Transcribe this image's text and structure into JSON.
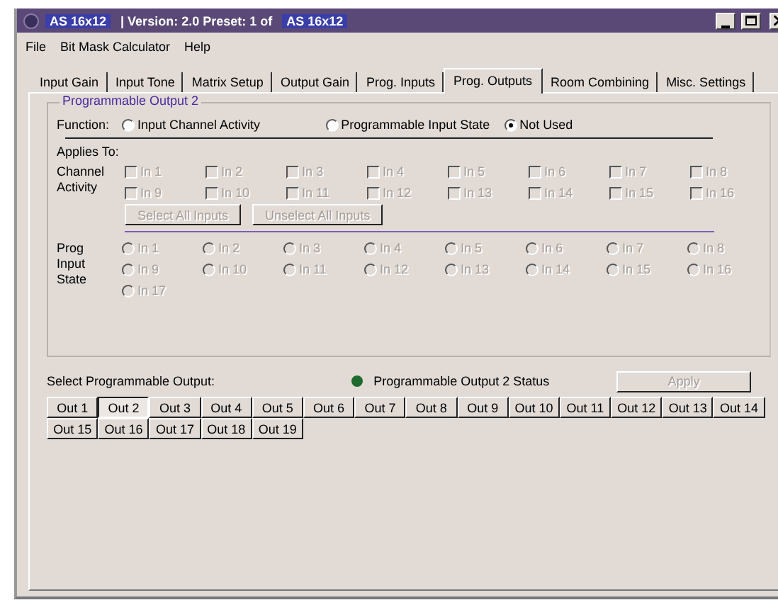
{
  "window": {
    "title_parts": [
      {
        "text": "AS 16x12",
        "highlighted": true
      },
      {
        "text": "| Version: 2.0  Preset: 1 of",
        "highlighted": false
      },
      {
        "text": "AS 16x12",
        "highlighted": true
      }
    ]
  },
  "menu": [
    "File",
    "Bit Mask Calculator",
    "Help"
  ],
  "tabs": [
    {
      "label": "Input Gain",
      "selected": false
    },
    {
      "label": "Input Tone",
      "selected": false
    },
    {
      "label": "Matrix Setup",
      "selected": false
    },
    {
      "label": "Output Gain",
      "selected": false
    },
    {
      "label": "Prog. Inputs",
      "selected": false
    },
    {
      "label": "Prog. Outputs",
      "selected": true
    },
    {
      "label": "Room Combining",
      "selected": false
    },
    {
      "label": "Misc. Settings",
      "selected": false
    }
  ],
  "group": {
    "title": "Programmable Output 2",
    "function_label": "Function:",
    "function_options": [
      {
        "label": "Input Channel Activity",
        "selected": false
      },
      {
        "label": "Programmable Input State",
        "selected": false
      },
      {
        "label": "Not Used",
        "selected": true
      }
    ],
    "applies_to": "Applies To:",
    "channel_activity": {
      "label": "Channel Activity",
      "items": [
        {
          "label": "In 1",
          "checked": false,
          "disabled": true
        },
        {
          "label": "In 2",
          "checked": false,
          "disabled": true
        },
        {
          "label": "In 3",
          "checked": false,
          "disabled": true
        },
        {
          "label": "In 4",
          "checked": false,
          "disabled": true
        },
        {
          "label": "In 5",
          "checked": false,
          "disabled": true
        },
        {
          "label": "In 6",
          "checked": false,
          "disabled": true
        },
        {
          "label": "In 7",
          "checked": false,
          "disabled": true
        },
        {
          "label": "In 8",
          "checked": false,
          "disabled": true
        },
        {
          "label": "In 9",
          "checked": false,
          "disabled": true
        },
        {
          "label": "In 10",
          "checked": false,
          "disabled": true
        },
        {
          "label": "In 11",
          "checked": false,
          "disabled": true
        },
        {
          "label": "In 12",
          "checked": false,
          "disabled": true
        },
        {
          "label": "In 13",
          "checked": false,
          "disabled": true
        },
        {
          "label": "In 14",
          "checked": false,
          "disabled": true
        },
        {
          "label": "In 15",
          "checked": false,
          "disabled": true
        },
        {
          "label": "In 16",
          "checked": false,
          "disabled": true
        }
      ],
      "buttons": [
        {
          "label": "Select All Inputs",
          "disabled": true
        },
        {
          "label": "Unselect All Inputs",
          "disabled": true
        }
      ]
    },
    "prog_input_state": {
      "label": "Prog Input State",
      "items": [
        {
          "label": "In 1",
          "selected": false,
          "disabled": true
        },
        {
          "label": "In 2",
          "selected": false,
          "disabled": true
        },
        {
          "label": "In 3",
          "selected": false,
          "disabled": true
        },
        {
          "label": "In 4",
          "selected": false,
          "disabled": true
        },
        {
          "label": "In 5",
          "selected": false,
          "disabled": true
        },
        {
          "label": "In 6",
          "selected": false,
          "disabled": true
        },
        {
          "label": "In 7",
          "selected": false,
          "disabled": true
        },
        {
          "label": "In 8",
          "selected": false,
          "disabled": true
        },
        {
          "label": "In 9",
          "selected": false,
          "disabled": true
        },
        {
          "label": "In 10",
          "selected": false,
          "disabled": true
        },
        {
          "label": "In 11",
          "selected": false,
          "disabled": true
        },
        {
          "label": "In 12",
          "selected": false,
          "disabled": true
        },
        {
          "label": "In 13",
          "selected": false,
          "disabled": true
        },
        {
          "label": "In 14",
          "selected": false,
          "disabled": true
        },
        {
          "label": "In 15",
          "selected": false,
          "disabled": true
        },
        {
          "label": "In 16",
          "selected": false,
          "disabled": true
        },
        {
          "label": "In 17",
          "selected": false,
          "disabled": true
        }
      ]
    }
  },
  "bottom": {
    "select_label": "Select Programmable Output:",
    "status": {
      "label": "Programmable Output 2 Status",
      "color": "#1e6b2e"
    },
    "apply": {
      "label": "Apply",
      "disabled": true
    },
    "outputs": [
      {
        "label": "Out 1",
        "selected": false
      },
      {
        "label": "Out 2",
        "selected": true
      },
      {
        "label": "Out 3",
        "selected": false
      },
      {
        "label": "Out 4",
        "selected": false
      },
      {
        "label": "Out 5",
        "selected": false
      },
      {
        "label": "Out 6",
        "selected": false
      },
      {
        "label": "Out 7",
        "selected": false
      },
      {
        "label": "Out 8",
        "selected": false
      },
      {
        "label": "Out 9",
        "selected": false
      },
      {
        "label": "Out 10",
        "selected": false
      },
      {
        "label": "Out 11",
        "selected": false
      },
      {
        "label": "Out 12",
        "selected": false
      },
      {
        "label": "Out 13",
        "selected": false
      },
      {
        "label": "Out 14",
        "selected": false
      },
      {
        "label": "Out 15",
        "selected": false
      },
      {
        "label": "Out 16",
        "selected": false
      },
      {
        "label": "Out 17",
        "selected": false
      },
      {
        "label": "Out 18",
        "selected": false
      },
      {
        "label": "Out 19",
        "selected": false
      }
    ]
  }
}
